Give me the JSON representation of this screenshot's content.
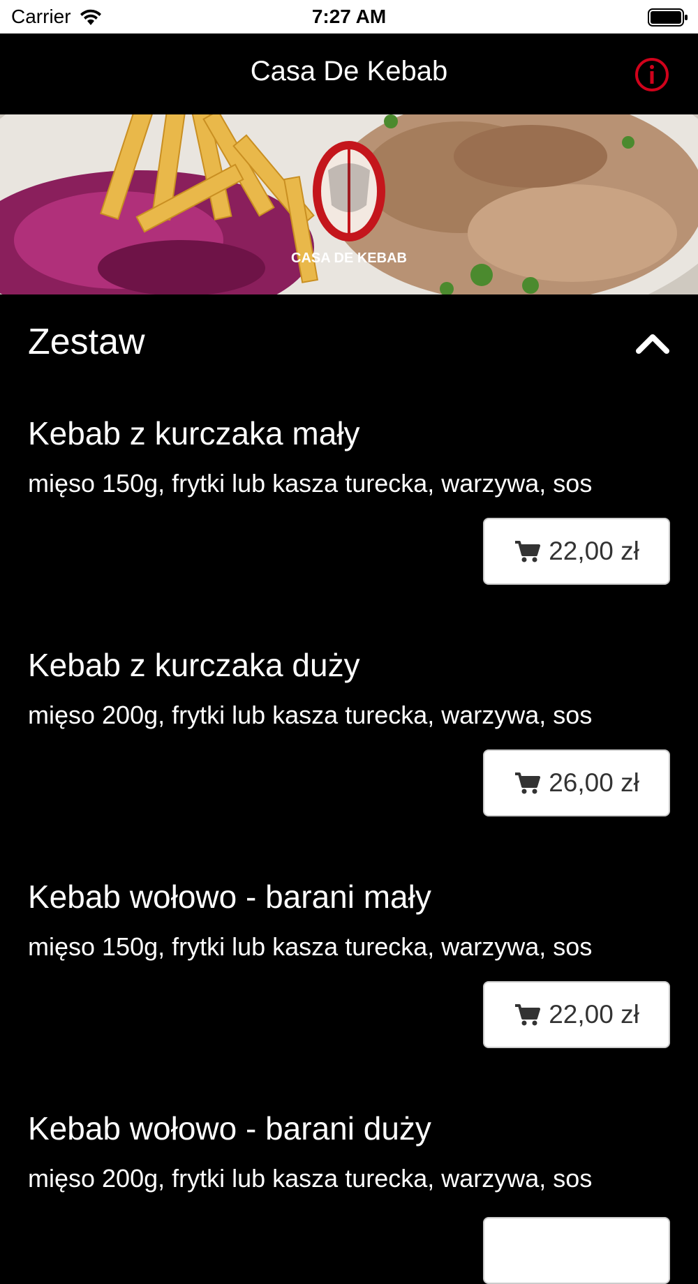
{
  "status_bar": {
    "carrier": "Carrier",
    "time": "7:27 AM"
  },
  "nav": {
    "title": "Casa De Kebab"
  },
  "hero": {
    "logo_text": "CASA DE KEBAB"
  },
  "section": {
    "title": "Zestaw",
    "expanded": true
  },
  "items": [
    {
      "name": "Kebab z kurczaka mały",
      "description": "mięso 150g, frytki lub kasza turecka, warzywa, sos",
      "price": "22,00 zł"
    },
    {
      "name": "Kebab z kurczaka duży",
      "description": "mięso 200g, frytki lub kasza turecka, warzywa, sos",
      "price": "26,00 zł"
    },
    {
      "name": "Kebab wołowo - barani mały",
      "description": "mięso 150g, frytki lub kasza turecka, warzywa, sos",
      "price": "22,00 zł"
    },
    {
      "name": "Kebab wołowo - barani duży",
      "description": "mięso 200g, frytki lub kasza turecka, warzywa, sos",
      "price": ""
    }
  ],
  "colors": {
    "accent_red": "#d0021b",
    "background": "#000000",
    "button_bg": "#ffffff"
  }
}
